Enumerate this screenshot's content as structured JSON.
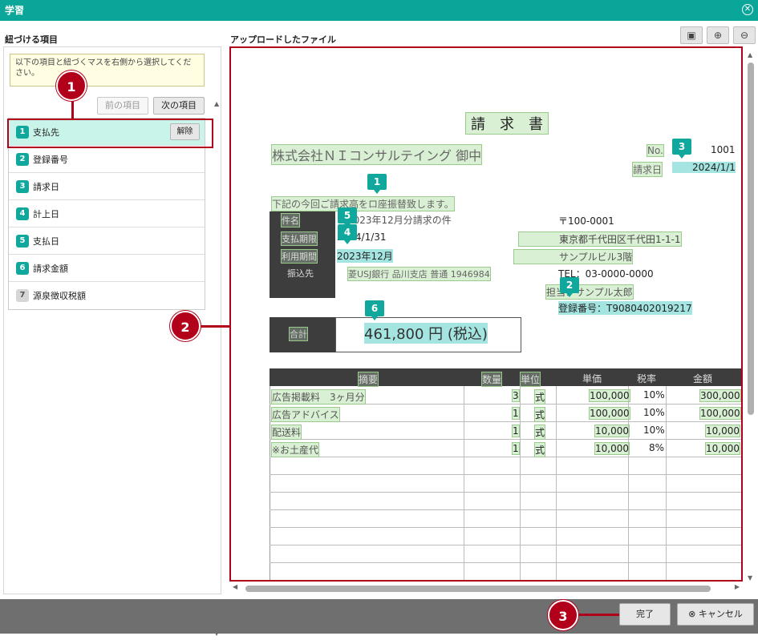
{
  "window": {
    "title": "学習"
  },
  "left_panel": {
    "heading": "紐づける項目",
    "note": "以下の項目と紐づくマスを右側から選択してください。",
    "prev_label": "前の項目",
    "next_label": "次の項目",
    "clear_label": "解除",
    "items": [
      {
        "num": "1",
        "label": "支払先"
      },
      {
        "num": "2",
        "label": "登録番号"
      },
      {
        "num": "3",
        "label": "請求日"
      },
      {
        "num": "4",
        "label": "計上日"
      },
      {
        "num": "5",
        "label": "支払日"
      },
      {
        "num": "6",
        "label": "請求金額"
      },
      {
        "num": "7",
        "label": "源泉徴収税額"
      }
    ]
  },
  "right_panel": {
    "heading": "アップロードしたファイル"
  },
  "callouts": [
    "1",
    "2",
    "3"
  ],
  "footer": {
    "done_label": "完了",
    "cancel_label": "キャンセル"
  },
  "document": {
    "title": "請　求　書",
    "customer": "株式会社ＮＩコンサルテイング 御中",
    "no_label": "No.",
    "no_value": "1001",
    "date_label": "請求日",
    "date_value": "2024/1/1",
    "intro": "下記の今回ご請求高をロ座振替致します。",
    "subject_label": "件名",
    "subject_value": "2023年12月分請求の件",
    "due_label": "支払期限",
    "due_value": "2024/1/31",
    "period_label": "利用期間",
    "period_value": "2023年12月",
    "bank_label": "振込先",
    "bank_value": "菱USJ銀行 品川支店 普通 1946984",
    "postal": "〒100-0001",
    "address": "東京都千代田区千代田1-1-1",
    "building": "サンプルビル3階",
    "tel": "TEL：03-0000-0000",
    "contact": "担当：サンプル太郎",
    "reg_no": "登録番号：T9080402019217",
    "total_label": "合計",
    "total_value": "461,800 円 (税込)",
    "table_headers": [
      "摘要",
      "数量",
      "単位",
      "単価",
      "税率",
      "金額"
    ],
    "rows": [
      {
        "desc": "広告掲載料　3ヶ月分",
        "qty": "3",
        "unit": "式",
        "price": "100,000",
        "tax": "10%",
        "amount": "300,000"
      },
      {
        "desc": "広告アドバイス",
        "qty": "1",
        "unit": "式",
        "price": "100,000",
        "tax": "10%",
        "amount": "100,000"
      },
      {
        "desc": "配送料",
        "qty": "1",
        "unit": "式",
        "price": "10,000",
        "tax": "10%",
        "amount": "10,000"
      },
      {
        "desc": "※お土産代",
        "qty": "1",
        "unit": "式",
        "price": "10,000",
        "tax": "8%",
        "amount": "10,000"
      }
    ],
    "markers": [
      "1",
      "2",
      "3",
      "4",
      "5",
      "6"
    ]
  },
  "icons": {
    "close": "close-icon",
    "fit": "fit-page-icon",
    "zoom_in": "zoom-in-icon",
    "zoom_out": "zoom-out-icon",
    "cancel": "cancel-x-icon"
  },
  "colors": {
    "title_bar": "#0aa69a",
    "accent": "#10a79c",
    "highlight_red": "#b2001a",
    "footer": "#6f6f6f"
  }
}
